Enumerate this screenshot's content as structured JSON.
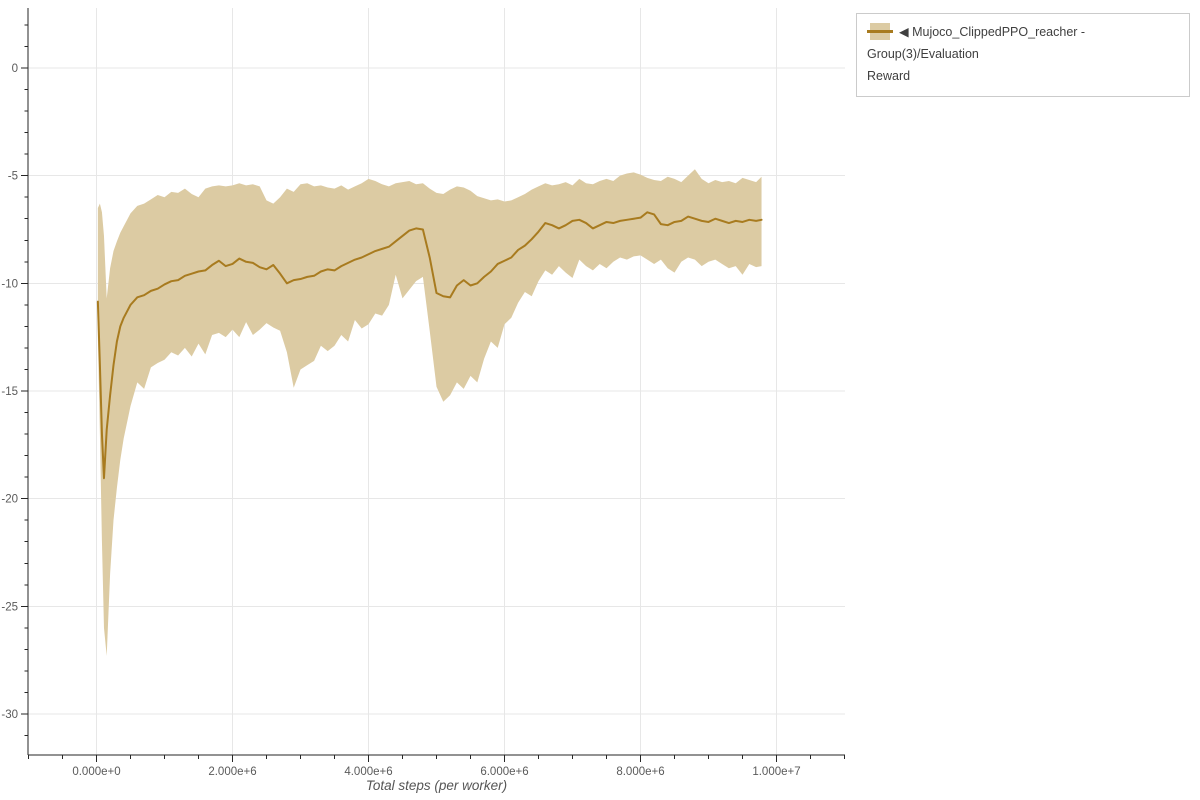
{
  "colors": {
    "line": "#a87b1f",
    "band": "#dccba3",
    "grid": "#e7e7e7",
    "axis": "#262626",
    "tick_label": "#5a5a5a",
    "axis_title": "#555555",
    "legend_text": "#3f3f3f",
    "legend_border": "#cbcbcb",
    "background": "#ffffff"
  },
  "legend": {
    "label": "◀ Mujoco_ClippedPPO_reacher - Group(3)/Evaluation Reward",
    "label_line1": "◀ Mujoco_ClippedPPO_reacher - Group(3)/Evaluation",
    "label_line2": "Reward"
  },
  "chart_data": {
    "type": "line",
    "title": "",
    "xlabel": "Total steps (per worker)",
    "ylabel": "",
    "grid": true,
    "legend_position": "top-right",
    "xlim_steps": [
      -1000000,
      11000000
    ],
    "ylim": [
      -31.9,
      2.8
    ],
    "x_tick_values_millions": [
      0,
      2,
      4,
      6,
      8,
      10
    ],
    "x_tick_labels": [
      "0.000e+0",
      "2.000e+6",
      "4.000e+6",
      "6.000e+6",
      "8.000e+6",
      "1.000e+7"
    ],
    "x_minor_step_millions": 0.5,
    "y_tick_values": [
      0,
      -5,
      -10,
      -15,
      -20,
      -25,
      -30
    ],
    "y_tick_labels": [
      "0",
      "-5",
      "-10",
      "-15",
      "-20",
      "-25",
      "-30"
    ],
    "y_minor_step": 1,
    "series": [
      {
        "name": "Mujoco_ClippedPPO_reacher - Group(3)/Evaluation Reward",
        "x_steps_millions": [
          0.02,
          0.05,
          0.08,
          0.11,
          0.15,
          0.2,
          0.25,
          0.3,
          0.35,
          0.4,
          0.5,
          0.6,
          0.7,
          0.8,
          0.9,
          1.0,
          1.1,
          1.2,
          1.3,
          1.4,
          1.5,
          1.6,
          1.7,
          1.8,
          1.9,
          2.0,
          2.1,
          2.2,
          2.3,
          2.4,
          2.5,
          2.6,
          2.7,
          2.8,
          2.9,
          3.0,
          3.1,
          3.2,
          3.3,
          3.4,
          3.5,
          3.6,
          3.7,
          3.8,
          3.9,
          4.0,
          4.1,
          4.2,
          4.3,
          4.4,
          4.5,
          4.6,
          4.7,
          4.8,
          4.9,
          5.0,
          5.1,
          5.2,
          5.3,
          5.4,
          5.5,
          5.6,
          5.7,
          5.8,
          5.9,
          6.0,
          6.1,
          6.2,
          6.3,
          6.4,
          6.5,
          6.6,
          6.7,
          6.8,
          6.9,
          7.0,
          7.1,
          7.2,
          7.3,
          7.4,
          7.5,
          7.6,
          7.7,
          7.8,
          7.9,
          8.0,
          8.1,
          8.2,
          8.3,
          8.4,
          8.5,
          8.6,
          8.7,
          8.8,
          8.9,
          9.0,
          9.1,
          9.2,
          9.3,
          9.4,
          9.5,
          9.6,
          9.7,
          9.78
        ],
        "mean": [
          -10.85,
          -13.8,
          -17.0,
          -19.05,
          -16.8,
          -15.2,
          -13.8,
          -12.7,
          -12.0,
          -11.6,
          -11.0,
          -10.65,
          -10.55,
          -10.35,
          -10.25,
          -10.05,
          -9.9,
          -9.85,
          -9.65,
          -9.55,
          -9.45,
          -9.4,
          -9.15,
          -8.95,
          -9.2,
          -9.1,
          -8.85,
          -9.0,
          -9.05,
          -9.25,
          -9.35,
          -9.15,
          -9.55,
          -10.0,
          -9.85,
          -9.8,
          -9.7,
          -9.65,
          -9.45,
          -9.35,
          -9.4,
          -9.2,
          -9.05,
          -8.9,
          -8.8,
          -8.65,
          -8.5,
          -8.4,
          -8.3,
          -8.05,
          -7.8,
          -7.55,
          -7.45,
          -7.5,
          -8.8,
          -10.45,
          -10.6,
          -10.65,
          -10.1,
          -9.85,
          -10.1,
          -10.0,
          -9.7,
          -9.45,
          -9.1,
          -8.95,
          -8.8,
          -8.45,
          -8.25,
          -7.95,
          -7.6,
          -7.2,
          -7.3,
          -7.45,
          -7.3,
          -7.1,
          -7.05,
          -7.2,
          -7.45,
          -7.3,
          -7.15,
          -7.2,
          -7.1,
          -7.05,
          -7.0,
          -6.95,
          -6.7,
          -6.8,
          -7.25,
          -7.3,
          -7.15,
          -7.1,
          -6.9,
          -7.0,
          -7.1,
          -7.15,
          -7.0,
          -7.1,
          -7.2,
          -7.1,
          -7.15,
          -7.05,
          -7.1,
          -7.05
        ],
        "band_high": [
          -6.5,
          -6.3,
          -6.7,
          -7.8,
          -10.7,
          -9.3,
          -8.5,
          -8.05,
          -7.65,
          -7.35,
          -6.75,
          -6.4,
          -6.3,
          -6.1,
          -5.9,
          -6.0,
          -5.75,
          -5.8,
          -5.6,
          -5.85,
          -6.0,
          -5.6,
          -5.5,
          -5.45,
          -5.5,
          -5.45,
          -5.35,
          -5.45,
          -5.4,
          -5.5,
          -6.15,
          -6.3,
          -6.0,
          -5.6,
          -5.75,
          -5.4,
          -5.35,
          -5.5,
          -5.45,
          -5.55,
          -5.6,
          -5.45,
          -5.65,
          -5.5,
          -5.35,
          -5.15,
          -5.25,
          -5.4,
          -5.5,
          -5.35,
          -5.3,
          -5.25,
          -5.4,
          -5.35,
          -5.6,
          -5.8,
          -5.85,
          -5.65,
          -5.5,
          -5.55,
          -5.7,
          -5.95,
          -6.05,
          -6.15,
          -6.1,
          -6.2,
          -6.15,
          -6.0,
          -5.85,
          -5.65,
          -5.5,
          -5.35,
          -5.45,
          -5.4,
          -5.3,
          -5.45,
          -5.15,
          -5.35,
          -5.4,
          -5.25,
          -5.15,
          -5.25,
          -5.0,
          -4.9,
          -4.85,
          -4.95,
          -5.1,
          -5.2,
          -5.25,
          -5.05,
          -5.15,
          -5.3,
          -5.0,
          -4.7,
          -5.15,
          -5.35,
          -5.2,
          -5.3,
          -5.25,
          -5.35,
          -5.1,
          -5.2,
          -5.3,
          -5.05
        ],
        "band_low": [
          -12.5,
          -17.0,
          -22.0,
          -26.0,
          -27.3,
          -23.5,
          -21.0,
          -19.5,
          -18.2,
          -17.2,
          -15.7,
          -14.6,
          -14.9,
          -13.9,
          -13.7,
          -13.55,
          -13.2,
          -13.35,
          -13.0,
          -13.4,
          -12.8,
          -13.3,
          -12.4,
          -12.3,
          -12.5,
          -12.15,
          -12.5,
          -11.8,
          -12.4,
          -12.15,
          -11.85,
          -12.05,
          -12.2,
          -13.2,
          -14.85,
          -14.0,
          -13.8,
          -13.6,
          -12.9,
          -13.15,
          -12.9,
          -12.4,
          -12.7,
          -11.7,
          -12.1,
          -11.9,
          -11.4,
          -11.5,
          -11.0,
          -9.6,
          -10.7,
          -10.3,
          -9.9,
          -9.7,
          -12.2,
          -14.8,
          -15.5,
          -15.2,
          -14.6,
          -14.9,
          -14.3,
          -14.6,
          -13.5,
          -12.7,
          -13.0,
          -11.9,
          -11.6,
          -10.9,
          -10.4,
          -10.6,
          -9.9,
          -9.4,
          -9.6,
          -9.2,
          -9.5,
          -9.75,
          -8.9,
          -9.2,
          -9.4,
          -9.1,
          -9.3,
          -9.0,
          -8.8,
          -8.9,
          -8.75,
          -8.7,
          -8.9,
          -9.1,
          -8.9,
          -9.3,
          -9.5,
          -9.0,
          -8.8,
          -8.9,
          -9.2,
          -9.0,
          -8.9,
          -9.1,
          -9.3,
          -9.2,
          -9.6,
          -9.1,
          -9.25,
          -9.2
        ]
      }
    ]
  }
}
